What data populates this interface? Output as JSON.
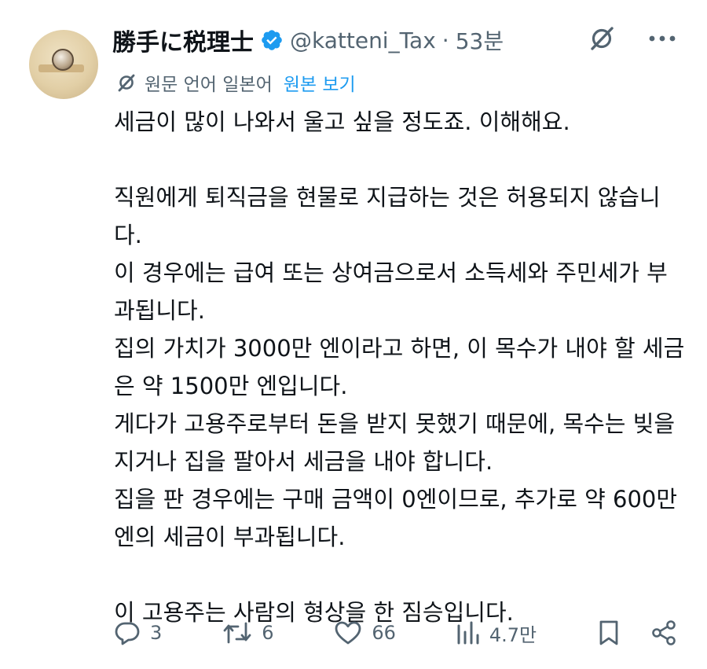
{
  "author": {
    "name": "勝手に税理士",
    "handle": "@katteni_Tax",
    "time": "53분"
  },
  "translation": {
    "lang_label": "원문 언어 일본어",
    "view_original": "원본 보기"
  },
  "text": {
    "line1": "세금이 많이 나와서 울고 싶을 정도죠. 이해해요.",
    "line2": "직원에게 퇴직금을 현물로 지급하는 것은 허용되지 않습니다.",
    "line3": "이 경우에는 급여 또는 상여금으로서 소득세와 주민세가 부과됩니다.",
    "line4": "집의 가치가 3000만 엔이라고 하면, 이 목수가 내야 할 세금은 약 1500만 엔입니다.",
    "line5": "게다가 고용주로부터 돈을 받지 못했기 때문에, 목수는 빚을 지거나 집을 팔아서 세금을 내야 합니다.",
    "line6": "집을 판 경우에는 구매 금액이 0엔이므로, 추가로 약 600만 엔의 세금이 부과됩니다.",
    "line7": "이 고용주는 사람의 형상을 한 짐승입니다."
  },
  "stats": {
    "replies": "3",
    "reposts": "6",
    "likes": "66",
    "views": "4.7만"
  },
  "icons": {
    "verified": "verified-badge-icon",
    "grok": "grok-icon",
    "more": "more-icon",
    "translate": "translate-icon",
    "reply": "reply-icon",
    "repost": "repost-icon",
    "like": "heart-icon",
    "views": "views-icon",
    "bookmark": "bookmark-icon",
    "share": "share-icon"
  },
  "colors": {
    "accent": "#1d9bf0",
    "text": "#0f1419",
    "muted": "#536471"
  }
}
